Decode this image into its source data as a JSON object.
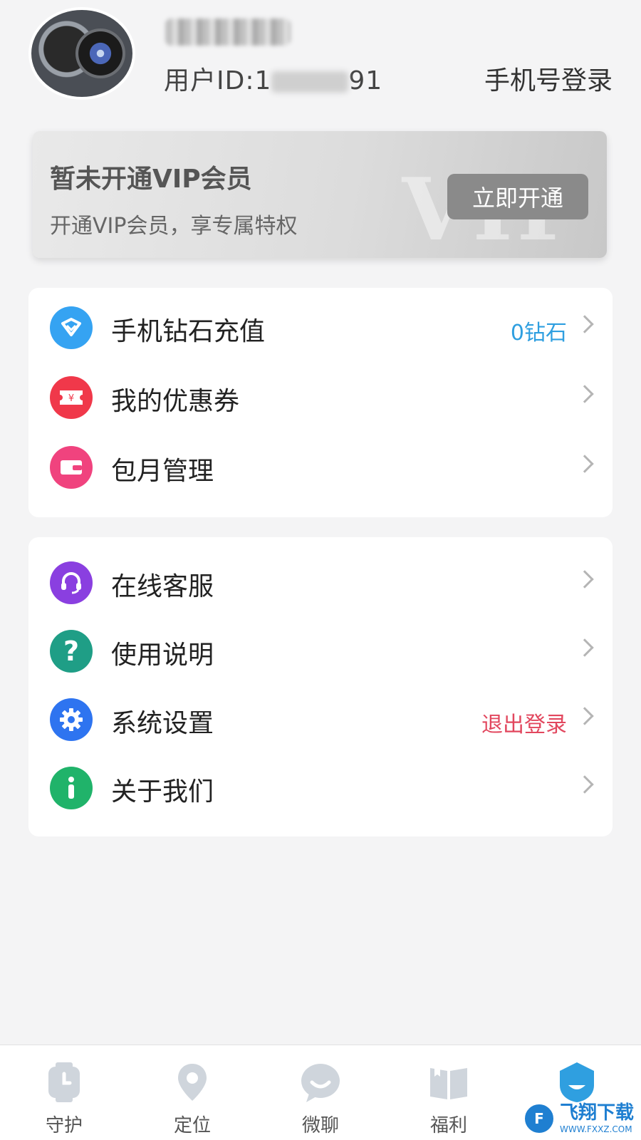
{
  "header": {
    "user_id_label": "用户ID:1",
    "user_id_suffix": "91",
    "login_link": "手机号登录"
  },
  "vip": {
    "title": "暂未开通VIP会员",
    "subtitle": "开通VIP会员，享专属特权",
    "button": "立即开通",
    "watermark": "VIP"
  },
  "menu_primary": [
    {
      "label": "手机钻石充值",
      "extra": "0钻石",
      "extra_color": "#2f9fe0",
      "icon": "diamond-icon",
      "icon_color": "#35a3f2"
    },
    {
      "label": "我的优惠券",
      "extra": "",
      "icon": "coupon-icon",
      "icon_color": "#f0384a"
    },
    {
      "label": "包月管理",
      "extra": "",
      "icon": "wallet-icon",
      "icon_color": "#f0437e"
    }
  ],
  "menu_secondary": [
    {
      "label": "在线客服",
      "extra": "",
      "icon": "headset-icon",
      "icon_color": "#8a3fe0"
    },
    {
      "label": "使用说明",
      "extra": "",
      "icon": "question-icon",
      "icon_color": "#1f9e86"
    },
    {
      "label": "系统设置",
      "extra": "退出登录",
      "extra_color": "#e2475e",
      "icon": "gear-icon",
      "icon_color": "#2e74f0"
    },
    {
      "label": "关于我们",
      "extra": "",
      "icon": "info-icon",
      "icon_color": "#20b36a"
    }
  ],
  "bottom_nav": [
    {
      "label": "守护",
      "icon": "watch-icon"
    },
    {
      "label": "定位",
      "icon": "location-pin-icon"
    },
    {
      "label": "微聊",
      "icon": "chat-bubble-icon"
    },
    {
      "label": "福利",
      "icon": "book-icon"
    },
    {
      "label": "",
      "icon": "profile-icon",
      "active": true
    }
  ],
  "watermark_logo": {
    "main": "飞翔下载",
    "sub": "WWW.FXXZ.COM"
  },
  "colors": {
    "accent_blue": "#2f9fe0",
    "logout_red": "#e2475e",
    "nav_inactive": "#cfd5dc",
    "nav_active": "#2f9fe0"
  }
}
